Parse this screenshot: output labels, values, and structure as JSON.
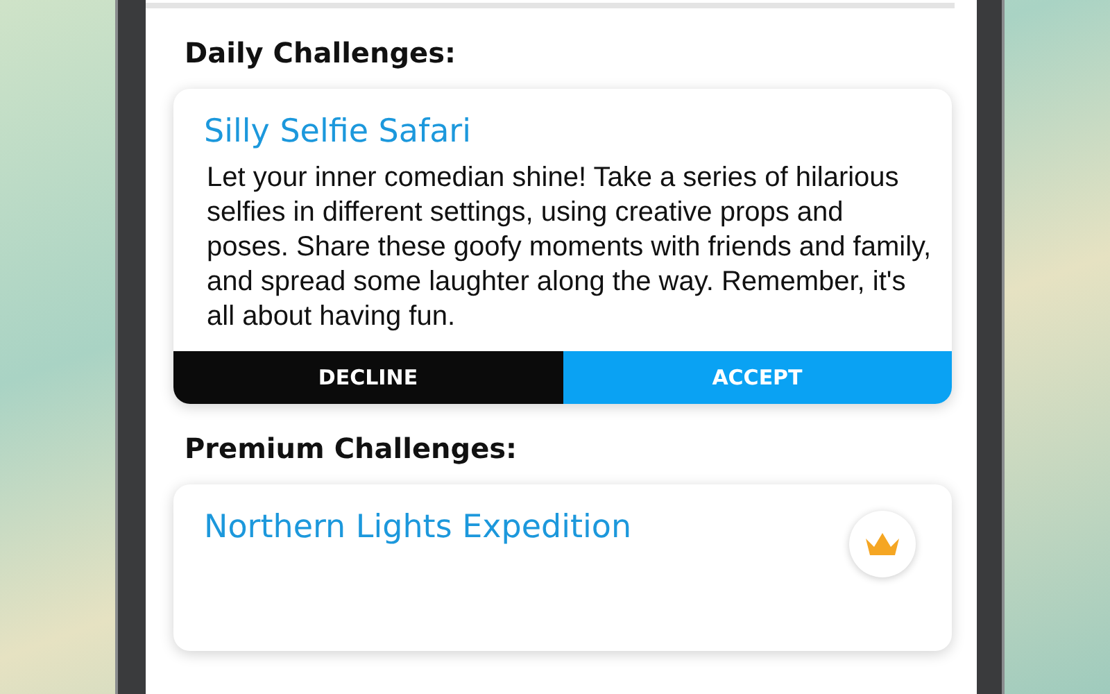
{
  "sections": [
    {
      "heading": "Daily Challenges:",
      "cards": [
        {
          "title": "Silly Selfie Safari",
          "premium": false,
          "description": "Let your inner comedian shine! Take a series of hilarious selfies in different settings, using creative props and poses. Share these goofy moments with friends and family, and spread some laughter along the way. Remember, it's all about having fun.",
          "buttons": [
            {
              "label": "DECLINE",
              "kind": "decline"
            },
            {
              "label": "ACCEPT",
              "kind": "accept"
            }
          ]
        }
      ]
    },
    {
      "heading": "Premium Challenges:",
      "cards": [
        {
          "title": "Northern Lights Expedition",
          "premium": true
        }
      ]
    }
  ]
}
